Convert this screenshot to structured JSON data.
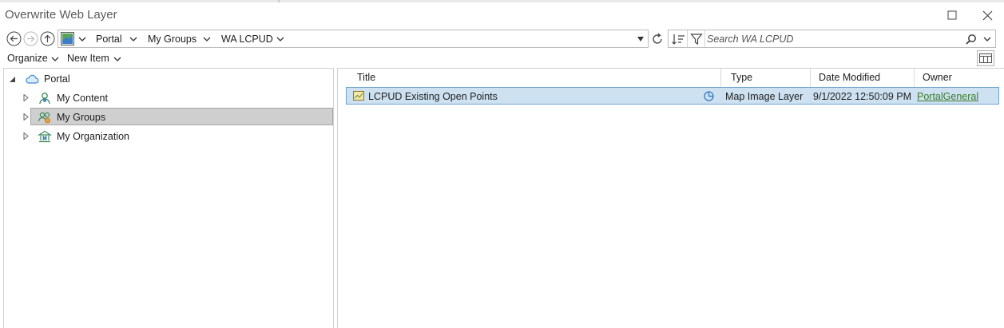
{
  "window": {
    "title": "Overwrite Web Layer"
  },
  "breadcrumb": {
    "items": [
      {
        "label": "Portal"
      },
      {
        "label": "My Groups"
      },
      {
        "label": "WA LCPUD"
      }
    ]
  },
  "search": {
    "placeholder": "Search WA LCPUD"
  },
  "menu": {
    "organize_label": "Organize",
    "new_item_label": "New Item"
  },
  "tree": {
    "root_label": "Portal",
    "items": [
      {
        "label": "My Content",
        "selected": false
      },
      {
        "label": "My Groups",
        "selected": true
      },
      {
        "label": "My Organization",
        "selected": false
      }
    ]
  },
  "table": {
    "columns": [
      "Title",
      "Type",
      "Date Modified",
      "Owner"
    ],
    "rows": [
      {
        "title": "LCPUD Existing Open Points",
        "type": "Map Image Layer",
        "date_modified": "9/1/2022 12:50:09 PM",
        "owner": "PortalGeneral",
        "selected": true
      }
    ]
  },
  "colors": {
    "selected_row_bg": "#cde1f1",
    "selected_row_border": "#6ea3cc",
    "selected_tree_bg": "#cfcfcf",
    "owner_link": "#3a7a2a",
    "portal_icon": "#3c8ad8"
  },
  "icons": {
    "back": "back-arrow-icon",
    "forward": "forward-arrow-icon",
    "up": "up-arrow-icon",
    "location": "map-thumbnail-icon",
    "refresh": "refresh-icon",
    "sort": "sort-icon",
    "filter": "filter-icon",
    "search": "search-icon",
    "view": "view-toggle-icon",
    "layer": "map-image-layer-icon",
    "shared": "shared-globe-icon"
  }
}
